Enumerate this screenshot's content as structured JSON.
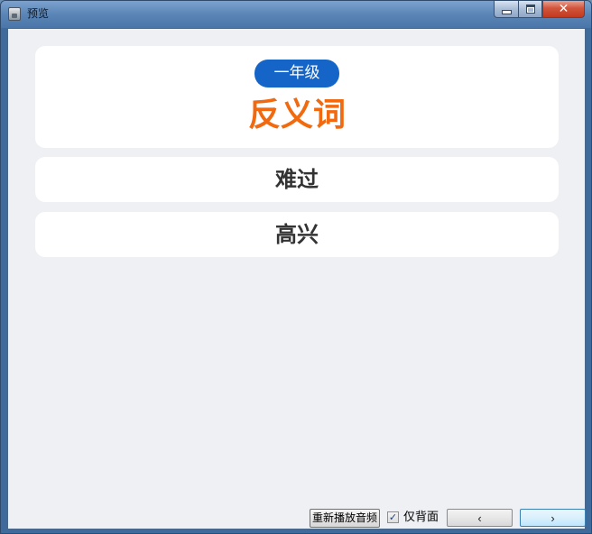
{
  "window": {
    "title": "预览",
    "close_glyph": "✕"
  },
  "title_card": {
    "grade_badge": "一年级",
    "heading": "反义词"
  },
  "words": [
    "难过",
    "高兴"
  ],
  "controls": {
    "replay_label": "重新播放音频",
    "checkbox_checked": true,
    "checkbox_mark": "✓",
    "checkbox_label": "仅背面",
    "prev_label": "‹",
    "next_label": "›"
  },
  "colors": {
    "heading": "#f26a10",
    "badge_bg": "#1565c9",
    "client_bg": "#eff0f4"
  },
  "icons": {
    "app": "app-icon",
    "minimize": "minimize-icon",
    "maximize": "maximize-icon",
    "close": "close-icon",
    "prev": "chevron-left-icon",
    "next": "chevron-right-icon"
  }
}
